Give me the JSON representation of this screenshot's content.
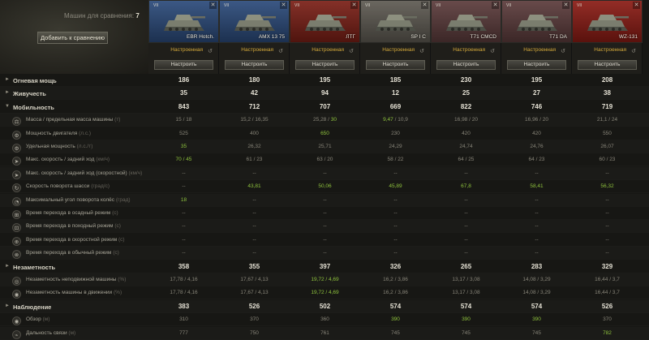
{
  "compare": {
    "label": "Машин для сравнения:",
    "count": "7",
    "add_button": "Добавить к сравнению"
  },
  "vehicles": [
    {
      "name": "EBR Hotch.",
      "tier": "VII",
      "flag_color": "#2b4a7a",
      "setup": "Настроенная",
      "configure": "Настроить"
    },
    {
      "name": "AMX 13 75",
      "tier": "VII",
      "flag_color": "#2b4a7a",
      "setup": "Настроенная",
      "configure": "Настроить"
    },
    {
      "name": "ЛТГ",
      "tier": "VII",
      "flag_color": "#7a1f16",
      "setup": "Настроенная",
      "configure": "Настроить"
    },
    {
      "name": "SP I C",
      "tier": "VII",
      "flag_color": "#5e5a52",
      "setup": "Настроенная",
      "configure": "Настроить"
    },
    {
      "name": "T71 CMCD",
      "tier": "VII",
      "flag_color": "#5b3b3b",
      "setup": "Настроенная",
      "configure": "Настроить"
    },
    {
      "name": "T71 DA",
      "tier": "VII",
      "flag_color": "#5b3b3b",
      "setup": "Настроенная",
      "configure": "Настроить"
    },
    {
      "name": "WZ-131",
      "tier": "VII",
      "flag_color": "#8a1b14",
      "setup": "Настроенная",
      "configure": "Настроить"
    }
  ],
  "rows": [
    {
      "type": "cat",
      "label": "Огневая мощь",
      "values": [
        "186",
        "180",
        "195",
        "185",
        "230",
        "195",
        "208"
      ],
      "good": [
        4
      ]
    },
    {
      "type": "cat",
      "label": "Живучесть",
      "values": [
        "35",
        "42",
        "94",
        "12",
        "25",
        "27",
        "38"
      ],
      "good": [
        2
      ]
    },
    {
      "type": "cat",
      "label": "Мобильность",
      "values": [
        "843",
        "712",
        "707",
        "669",
        "822",
        "746",
        "719"
      ],
      "good": [
        0
      ],
      "expanded": true
    },
    {
      "type": "param",
      "icon": "weight-icon",
      "label": "Масса / предельная масса машины",
      "unit": "(т)",
      "values": [
        "15 / 18",
        "15,2 / 16,35",
        "25,28 / 30",
        "9,47 / 10,9",
        "16,98 / 20",
        "16,96 / 20",
        "21,1 / 24"
      ],
      "good_partial": [
        2,
        3
      ]
    },
    {
      "type": "param",
      "icon": "engine-icon",
      "label": "Мощность двигателя",
      "unit": "(л.с.)",
      "values": [
        "525",
        "400",
        "650",
        "230",
        "420",
        "420",
        "550"
      ],
      "good": [
        2
      ]
    },
    {
      "type": "param",
      "icon": "power-ratio-icon",
      "label": "Удельная мощность",
      "unit": "(л.с./т)",
      "values": [
        "35",
        "26,32",
        "25,71",
        "24,29",
        "24,74",
        "24,76",
        "26,07"
      ],
      "good": [
        0
      ]
    },
    {
      "type": "param",
      "icon": "speed-icon",
      "label": "Макс. скорость / задний ход",
      "unit": "(км/ч)",
      "values": [
        "70 / 45",
        "61 / 23",
        "63 / 20",
        "58 / 22",
        "64 / 25",
        "64 / 23",
        "60 / 23"
      ],
      "good": [
        0
      ]
    },
    {
      "type": "param",
      "icon": "speed-mode-icon",
      "label": "Макс. скорость / задний ход (скоростной)",
      "unit": "(км/ч)",
      "values": [
        "--",
        "--",
        "--",
        "--",
        "--",
        "--",
        "--"
      ]
    },
    {
      "type": "param",
      "icon": "traverse-icon",
      "label": "Скорость поворота шасси",
      "unit": "(град/с)",
      "values": [
        "--",
        "43,81",
        "50,06",
        "45,89",
        "67,8",
        "58,41",
        "56,32"
      ],
      "good": [
        1,
        2,
        3,
        4,
        5,
        6
      ]
    },
    {
      "type": "param",
      "icon": "wheel-angle-icon",
      "label": "Максимальный угол поворота колёс",
      "unit": "(град)",
      "values": [
        "18",
        "--",
        "--",
        "--",
        "--",
        "--",
        "--"
      ],
      "good": [
        0
      ]
    },
    {
      "type": "param",
      "icon": "siege-mode-icon",
      "label": "Время перехода в осадный режим",
      "unit": "(с)",
      "values": [
        "--",
        "--",
        "--",
        "--",
        "--",
        "--",
        "--"
      ]
    },
    {
      "type": "param",
      "icon": "travel-mode-icon",
      "label": "Время перехода в походный режим",
      "unit": "(с)",
      "values": [
        "--",
        "--",
        "--",
        "--",
        "--",
        "--",
        "--"
      ]
    },
    {
      "type": "param",
      "icon": "fast-mode-icon",
      "label": "Время перехода в скоростной режим",
      "unit": "(с)",
      "values": [
        "--",
        "--",
        "--",
        "--",
        "--",
        "--",
        "--"
      ]
    },
    {
      "type": "param",
      "icon": "normal-mode-icon",
      "label": "Время перехода в обычный режим",
      "unit": "(с)",
      "values": [
        "--",
        "--",
        "--",
        "--",
        "--",
        "--",
        "--"
      ]
    },
    {
      "type": "cat",
      "label": "Незаметность",
      "values": [
        "358",
        "355",
        "397",
        "326",
        "265",
        "283",
        "329"
      ],
      "good": [
        2
      ]
    },
    {
      "type": "param",
      "icon": "camo-still-icon",
      "label": "Незаметность неподвижной машины",
      "unit": "(%)",
      "values": [
        "17,78 / 4,16",
        "17,67 / 4,13",
        "19,72 / 4,69",
        "16,2 / 3,86",
        "13,17 / 3,08",
        "14,08 / 3,29",
        "16,44 / 3,7"
      ],
      "good": [
        2
      ]
    },
    {
      "type": "param",
      "icon": "camo-moving-icon",
      "label": "Незаметность машины в движении",
      "unit": "(%)",
      "values": [
        "17,78 / 4,16",
        "17,67 / 4,13",
        "19,72 / 4,69",
        "16,2 / 3,86",
        "13,17 / 3,08",
        "14,08 / 3,29",
        "16,44 / 3,7"
      ],
      "good": [
        2
      ]
    },
    {
      "type": "cat",
      "label": "Наблюдение",
      "values": [
        "383",
        "526",
        "502",
        "574",
        "574",
        "574",
        "526"
      ],
      "good": [
        3,
        4,
        5
      ]
    },
    {
      "type": "param",
      "icon": "view-range-icon",
      "label": "Обзор",
      "unit": "(м)",
      "values": [
        "310",
        "370",
        "360",
        "390",
        "390",
        "390",
        "370"
      ],
      "good": [
        3,
        4,
        5
      ]
    },
    {
      "type": "param",
      "icon": "radio-icon",
      "label": "Дальность связи",
      "unit": "(м)",
      "values": [
        "777",
        "750",
        "761",
        "745",
        "745",
        "745",
        "782"
      ],
      "good": [
        6
      ]
    }
  ]
}
